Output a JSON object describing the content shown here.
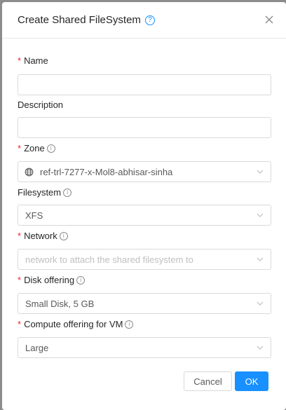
{
  "modal": {
    "title": "Create Shared FileSystem",
    "help_symbol": "?",
    "close_icon": "close-icon"
  },
  "fields": {
    "name": {
      "label": "Name",
      "required": true,
      "value": ""
    },
    "description": {
      "label": "Description",
      "required": false,
      "value": ""
    },
    "zone": {
      "label": "Zone",
      "required": true,
      "value": "ref-trl-7277-x-Mol8-abhisar-sinha",
      "icon": "globe-icon"
    },
    "filesystem": {
      "label": "Filesystem",
      "required": false,
      "value": "XFS"
    },
    "network": {
      "label": "Network",
      "required": true,
      "placeholder": "network to attach the shared filesystem to"
    },
    "disk_offering": {
      "label": "Disk offering",
      "required": true,
      "value": "Small Disk, 5 GB"
    },
    "compute_offering": {
      "label": "Compute offering for VM",
      "required": true,
      "value": "Large"
    }
  },
  "symbols": {
    "required": "*",
    "info": "i"
  },
  "buttons": {
    "cancel": "Cancel",
    "ok": "OK"
  },
  "colors": {
    "primary": "#1890ff",
    "required": "#f5222d",
    "border": "#d9d9d9"
  }
}
